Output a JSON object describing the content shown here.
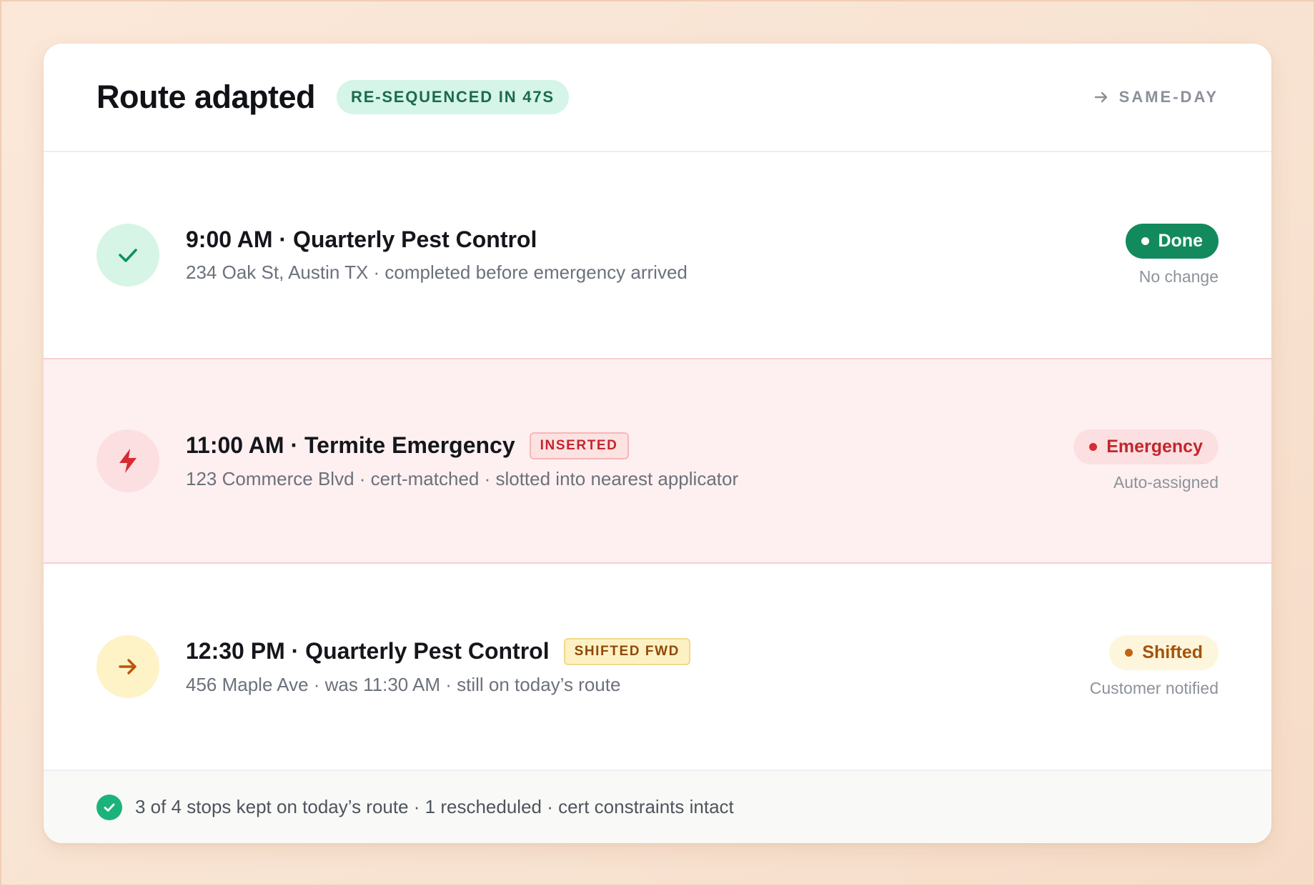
{
  "header": {
    "title": "Route adapted",
    "badge": "RE-SEQUENCED IN 47S",
    "link_label": "SAME-DAY",
    "link_icon": "arrow-right-icon"
  },
  "stops": [
    {
      "icon": "check-icon",
      "title": "9:00 AM · Quarterly Pest Control",
      "tag": "",
      "subtitle": "234 Oak St, Austin TX · completed before emergency arrived",
      "status": "Done",
      "note": "No change",
      "color": "#128a5e"
    },
    {
      "icon": "lightning-icon",
      "title": "11:00 AM · Termite Emergency",
      "tag": "INSERTED",
      "subtitle": "123 Commerce Blvd · cert-matched · slotted into nearest applicator",
      "status": "Emergency",
      "note": "Auto-assigned",
      "color": "#d72a31"
    },
    {
      "icon": "arrow-right-icon",
      "title": "12:30 PM · Quarterly Pest Control",
      "tag": "SHIFTED FWD",
      "subtitle": "456 Maple Ave · was 11:30 AM · still on today’s route",
      "status": "Shifted",
      "note": "Customer notified",
      "color": "#c3620f"
    }
  ],
  "footer": {
    "icon": "check-circle-icon",
    "text": "3 of 4 stops kept on today’s route · 1 rescheduled · cert constraints intact"
  }
}
